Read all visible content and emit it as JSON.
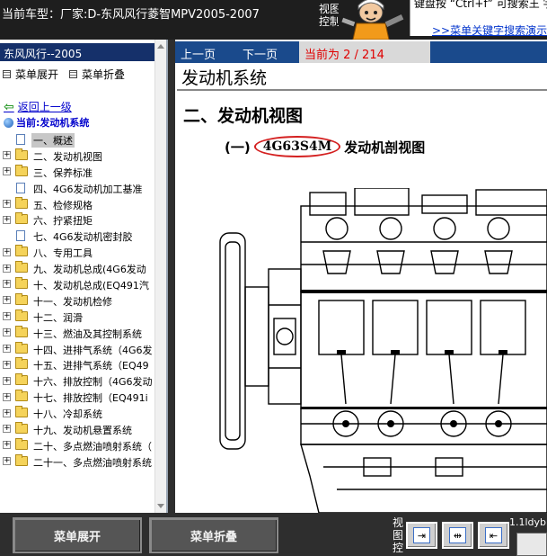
{
  "titlebar": {
    "car_model": "当前车型：厂家:D-东风风行菱智MPV2005-2007",
    "view_ctrl": "视图控制",
    "help_text": "键盘按 “Ctrl+f” 可搜索王 字！",
    "help_link": ">>菜单关键字搜索演示"
  },
  "sidebar": {
    "header": "东风风行--2005",
    "expand_label": "菜单展开",
    "collapse_label": "菜单折叠",
    "back_label": "返回上一级",
    "current_label": "当前:发动机系统",
    "items": [
      {
        "label": "一、概述",
        "type": "page",
        "selected": true
      },
      {
        "label": "二、发动机视图",
        "type": "folder"
      },
      {
        "label": "三、保养标准",
        "type": "folder"
      },
      {
        "label": "四、4G6发动机加工基准",
        "type": "page"
      },
      {
        "label": "五、检修规格",
        "type": "folder"
      },
      {
        "label": "六、拧紧扭矩",
        "type": "folder"
      },
      {
        "label": "七、4G6发动机密封胶",
        "type": "page"
      },
      {
        "label": "八、专用工具",
        "type": "folder"
      },
      {
        "label": "九、发动机总成(4G6发动",
        "type": "folder"
      },
      {
        "label": "十、发动机总成(EQ491汽",
        "type": "folder"
      },
      {
        "label": "十一、发动机检修",
        "type": "folder"
      },
      {
        "label": "十二、润滑",
        "type": "folder"
      },
      {
        "label": "十三、燃油及其控制系统",
        "type": "folder"
      },
      {
        "label": "十四、进排气系统（4G6发",
        "type": "folder"
      },
      {
        "label": "十五、进排气系统（EQ49",
        "type": "folder"
      },
      {
        "label": "十六、排放控制（4G6发动",
        "type": "folder"
      },
      {
        "label": "十七、排放控制（EQ491i",
        "type": "folder"
      },
      {
        "label": "十八、冷却系统",
        "type": "folder"
      },
      {
        "label": "十九、发动机悬置系统",
        "type": "folder"
      },
      {
        "label": "二十、多点燃油喷射系统（",
        "type": "folder"
      },
      {
        "label": "二十一、多点燃油喷射系统",
        "type": "folder"
      }
    ]
  },
  "content": {
    "prev_label": "上一页",
    "next_label": "下一页",
    "page_indicator": "当前为 2 / 214",
    "section_title": "发动机系统",
    "doc_heading": "二、发动机视图",
    "sub_prefix": "(一)",
    "engine_code": "4G63S4M",
    "sub_suffix": "发动机剖视图"
  },
  "bottombar": {
    "expand_button": "菜单展开",
    "collapse_button": "菜单折叠",
    "view_ctrl": "视图控",
    "ctrl_icons": [
      "dock-right-icon",
      "split-view-icon",
      "dock-left-icon"
    ],
    "version_text": "1.1ldyb"
  },
  "colors": {
    "navbar": "#1a4a8c",
    "sidebar_header": "#15306a",
    "page_indicator_text": "#e00000",
    "highlight_ring": "#d42020"
  }
}
